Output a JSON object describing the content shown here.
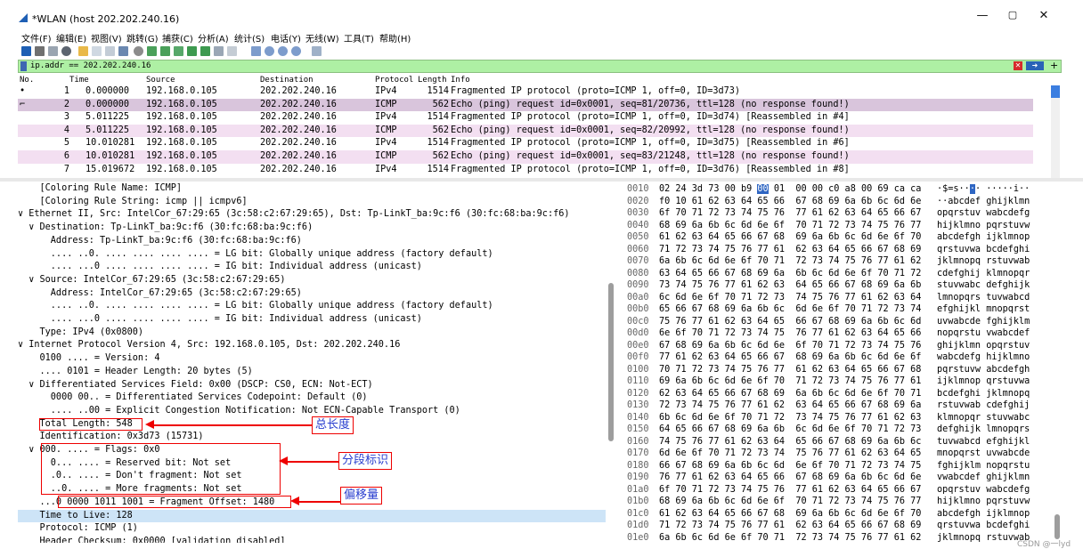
{
  "window": {
    "title": "*WLAN (host 202.202.240.16)",
    "controls": [
      "—",
      "▢",
      "✕"
    ]
  },
  "menu": [
    "文件(F)",
    "编辑(E)",
    "视图(V)",
    "跳转(G)",
    "捕获(C)",
    "分析(A)",
    "统计(S)",
    "电话(Y)",
    "无线(W)",
    "工具(T)",
    "帮助(H)"
  ],
  "filter": {
    "text": "ip.addr == 202.202.240.16",
    "plus": "+"
  },
  "packet_list": {
    "columns": [
      "No.",
      "Time",
      "Source",
      "Destination",
      "Protocol",
      "Length",
      "Info"
    ],
    "rows": [
      {
        "marker": "•",
        "no": "1",
        "time": "0.000000",
        "src": "192.168.0.105",
        "dst": "202.202.240.16",
        "proto": "IPv4",
        "len": "1514",
        "info": "Fragmented IP protocol (proto=ICMP 1, off=0, ID=3d73)",
        "style": "ipv4"
      },
      {
        "marker": "⌐",
        "no": "2",
        "time": "0.000000",
        "src": "192.168.0.105",
        "dst": "202.202.240.16",
        "proto": "ICMP",
        "len": "562",
        "info": "Echo (ping) request  id=0x0001, seq=81/20736, ttl=128 (no response found!)",
        "style": "sel"
      },
      {
        "marker": "",
        "no": "3",
        "time": "5.011225",
        "src": "192.168.0.105",
        "dst": "202.202.240.16",
        "proto": "IPv4",
        "len": "1514",
        "info": "Fragmented IP protocol (proto=ICMP 1, off=0, ID=3d74) [Reassembled in #4]",
        "style": "ipv4"
      },
      {
        "marker": "",
        "no": "4",
        "time": "5.011225",
        "src": "192.168.0.105",
        "dst": "202.202.240.16",
        "proto": "ICMP",
        "len": "562",
        "info": "Echo (ping) request  id=0x0001, seq=82/20992, ttl=128 (no response found!)",
        "style": "icmp"
      },
      {
        "marker": "",
        "no": "5",
        "time": "10.010281",
        "src": "192.168.0.105",
        "dst": "202.202.240.16",
        "proto": "IPv4",
        "len": "1514",
        "info": "Fragmented IP protocol (proto=ICMP 1, off=0, ID=3d75) [Reassembled in #6]",
        "style": "ipv4"
      },
      {
        "marker": "",
        "no": "6",
        "time": "10.010281",
        "src": "192.168.0.105",
        "dst": "202.202.240.16",
        "proto": "ICMP",
        "len": "562",
        "info": "Echo (ping) request  id=0x0001, seq=83/21248, ttl=128 (no response found!)",
        "style": "icmp"
      },
      {
        "marker": "",
        "no": "7",
        "time": "15.019672",
        "src": "192.168.0.105",
        "dst": "202.202.240.16",
        "proto": "IPv4",
        "len": "1514",
        "info": "Fragmented IP protocol (proto=ICMP 1, off=0, ID=3d76) [Reassembled in #8]",
        "style": "ipv4"
      }
    ]
  },
  "details": [
    "    [Coloring Rule Name: ICMP]",
    "    [Coloring Rule String: icmp || icmpv6]",
    "∨ Ethernet II, Src: IntelCor_67:29:65 (3c:58:c2:67:29:65), Dst: Tp-LinkT_ba:9c:f6 (30:fc:68:ba:9c:f6)",
    "  ∨ Destination: Tp-LinkT_ba:9c:f6 (30:fc:68:ba:9c:f6)",
    "      Address: Tp-LinkT_ba:9c:f6 (30:fc:68:ba:9c:f6)",
    "      .... ..0. .... .... .... .... = LG bit: Globally unique address (factory default)",
    "      .... ...0 .... .... .... .... = IG bit: Individual address (unicast)",
    "  ∨ Source: IntelCor_67:29:65 (3c:58:c2:67:29:65)",
    "      Address: IntelCor_67:29:65 (3c:58:c2:67:29:65)",
    "      .... ..0. .... .... .... .... = LG bit: Globally unique address (factory default)",
    "      .... ...0 .... .... .... .... = IG bit: Individual address (unicast)",
    "    Type: IPv4 (0x0800)",
    "∨ Internet Protocol Version 4, Src: 192.168.0.105, Dst: 202.202.240.16",
    "    0100 .... = Version: 4",
    "    .... 0101 = Header Length: 20 bytes (5)",
    "  ∨ Differentiated Services Field: 0x00 (DSCP: CS0, ECN: Not-ECT)",
    "      0000 00.. = Differentiated Services Codepoint: Default (0)",
    "      .... ..00 = Explicit Congestion Notification: Not ECN-Capable Transport (0)",
    "    Total Length: 548",
    "    Identification: 0x3d73 (15731)",
    "  ∨ 000. .... = Flags: 0x0",
    "      0... .... = Reserved bit: Not set",
    "      .0.. .... = Don't fragment: Not set",
    "      ..0. .... = More fragments: Not set",
    "    ...0 0000 1011 1001 = Fragment Offset: 1480",
    "    Time to Live: 128",
    "    Protocol: ICMP (1)",
    "    Header Checksum: 0x0000 [validation disabled]"
  ],
  "highlighted_detail_index": 25,
  "annotations": {
    "total_length": "总长度",
    "flags": "分段标识",
    "offset": "偏移量"
  },
  "bytes": [
    {
      "off": "0010",
      "hex_pre": "02 24 3d 73 00 b9 ",
      "hex_sel": "00",
      "hex_post": " 01  00 00 c0 a8 00 69 ca ca",
      "asc_pre": "·$=s··",
      "asc_sel": "·",
      "asc_post": "· ·····i··"
    },
    {
      "off": "0020",
      "hex": "f0 10 61 62 63 64 65 66  67 68 69 6a 6b 6c 6d 6e",
      "asc": "··abcdef ghijklmn"
    },
    {
      "off": "0030",
      "hex": "6f 70 71 72 73 74 75 76  77 61 62 63 64 65 66 67",
      "asc": "opqrstuv wabcdefg"
    },
    {
      "off": "0040",
      "hex": "68 69 6a 6b 6c 6d 6e 6f  70 71 72 73 74 75 76 77",
      "asc": "hijklmno pqrstuvw"
    },
    {
      "off": "0050",
      "hex": "61 62 63 64 65 66 67 68  69 6a 6b 6c 6d 6e 6f 70",
      "asc": "abcdefgh ijklmnop"
    },
    {
      "off": "0060",
      "hex": "71 72 73 74 75 76 77 61  62 63 64 65 66 67 68 69",
      "asc": "qrstuvwa bcdefghi"
    },
    {
      "off": "0070",
      "hex": "6a 6b 6c 6d 6e 6f 70 71  72 73 74 75 76 77 61 62",
      "asc": "jklmnopq rstuvwab"
    },
    {
      "off": "0080",
      "hex": "63 64 65 66 67 68 69 6a  6b 6c 6d 6e 6f 70 71 72",
      "asc": "cdefghij klmnopqr"
    },
    {
      "off": "0090",
      "hex": "73 74 75 76 77 61 62 63  64 65 66 67 68 69 6a 6b",
      "asc": "stuvwabc defghijk"
    },
    {
      "off": "00a0",
      "hex": "6c 6d 6e 6f 70 71 72 73  74 75 76 77 61 62 63 64",
      "asc": "lmnopqrs tuvwabcd"
    },
    {
      "off": "00b0",
      "hex": "65 66 67 68 69 6a 6b 6c  6d 6e 6f 70 71 72 73 74",
      "asc": "efghijkl mnopqrst"
    },
    {
      "off": "00c0",
      "hex": "75 76 77 61 62 63 64 65  66 67 68 69 6a 6b 6c 6d",
      "asc": "uvwabcde fghijklm"
    },
    {
      "off": "00d0",
      "hex": "6e 6f 70 71 72 73 74 75  76 77 61 62 63 64 65 66",
      "asc": "nopqrstu vwabcdef"
    },
    {
      "off": "00e0",
      "hex": "67 68 69 6a 6b 6c 6d 6e  6f 70 71 72 73 74 75 76",
      "asc": "ghijklmn opqrstuv"
    },
    {
      "off": "00f0",
      "hex": "77 61 62 63 64 65 66 67  68 69 6a 6b 6c 6d 6e 6f",
      "asc": "wabcdefg hijklmno"
    },
    {
      "off": "0100",
      "hex": "70 71 72 73 74 75 76 77  61 62 63 64 65 66 67 68",
      "asc": "pqrstuvw abcdefgh"
    },
    {
      "off": "0110",
      "hex": "69 6a 6b 6c 6d 6e 6f 70  71 72 73 74 75 76 77 61",
      "asc": "ijklmnop qrstuvwa"
    },
    {
      "off": "0120",
      "hex": "62 63 64 65 66 67 68 69  6a 6b 6c 6d 6e 6f 70 71",
      "asc": "bcdefghi jklmnopq"
    },
    {
      "off": "0130",
      "hex": "72 73 74 75 76 77 61 62  63 64 65 66 67 68 69 6a",
      "asc": "rstuvwab cdefghij"
    },
    {
      "off": "0140",
      "hex": "6b 6c 6d 6e 6f 70 71 72  73 74 75 76 77 61 62 63",
      "asc": "klmnopqr stuvwabc"
    },
    {
      "off": "0150",
      "hex": "64 65 66 67 68 69 6a 6b  6c 6d 6e 6f 70 71 72 73",
      "asc": "defghijk lmnopqrs"
    },
    {
      "off": "0160",
      "hex": "74 75 76 77 61 62 63 64  65 66 67 68 69 6a 6b 6c",
      "asc": "tuvwabcd efghijkl"
    },
    {
      "off": "0170",
      "hex": "6d 6e 6f 70 71 72 73 74  75 76 77 61 62 63 64 65",
      "asc": "mnopqrst uvwabcde"
    },
    {
      "off": "0180",
      "hex": "66 67 68 69 6a 6b 6c 6d  6e 6f 70 71 72 73 74 75",
      "asc": "fghijklm nopqrstu"
    },
    {
      "off": "0190",
      "hex": "76 77 61 62 63 64 65 66  67 68 69 6a 6b 6c 6d 6e",
      "asc": "vwabcdef ghijklmn"
    },
    {
      "off": "01a0",
      "hex": "6f 70 71 72 73 74 75 76  77 61 62 63 64 65 66 67",
      "asc": "opqrstuv wabcdefg"
    },
    {
      "off": "01b0",
      "hex": "68 69 6a 6b 6c 6d 6e 6f  70 71 72 73 74 75 76 77",
      "asc": "hijklmno pqrstuvw"
    },
    {
      "off": "01c0",
      "hex": "61 62 63 64 65 66 67 68  69 6a 6b 6c 6d 6e 6f 70",
      "asc": "abcdefgh ijklmnop"
    },
    {
      "off": "01d0",
      "hex": "71 72 73 74 75 76 77 61  62 63 64 65 66 67 68 69",
      "asc": "qrstuvwa bcdefghi"
    },
    {
      "off": "01e0",
      "hex": "6a 6b 6c 6d 6e 6f 70 71  72 73 74 75 76 77 61 62",
      "asc": "jklmnopq rstuvwab"
    }
  ],
  "watermark": "CSDN @一lyd",
  "colors": {
    "filter_bg": "#aef0a4",
    "icmp_row": "#f3dff1",
    "selected_row": "#d9c5dc",
    "selected_detail": "#cde4f7",
    "annotation": "#ee0000",
    "annotation_text": "#2a3fcf"
  }
}
